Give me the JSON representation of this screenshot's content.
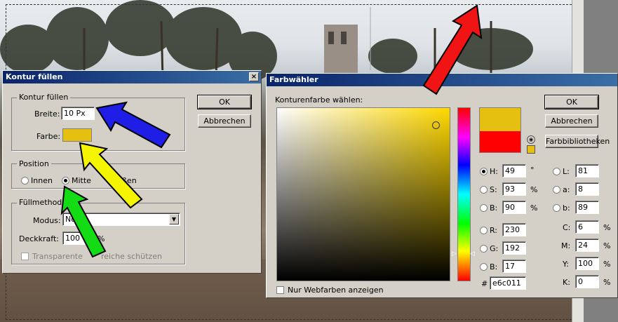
{
  "fill_dialog": {
    "title": "Kontur füllen",
    "close": "×",
    "group_stroke": "Kontur füllen",
    "width_label": "Breite:",
    "width_value": "10 Px",
    "color_label": "Farbe:",
    "color_value": "#e6c011",
    "group_position": "Position",
    "pos_inside": "Innen",
    "pos_center": "Mitte",
    "pos_outside_partial": "ßen",
    "group_blend": "Füllmethod",
    "mode_label": "Modus:",
    "mode_value": "No",
    "opacity_label": "Deckkraft:",
    "opacity_value": "100",
    "opacity_unit": "%",
    "preserve_label_a": "Transparente",
    "preserve_label_b": "reiche schützen",
    "ok": "OK",
    "cancel": "Abbrechen"
  },
  "picker": {
    "title": "Farbwähler",
    "subtitle": "Konturenfarbe wählen:",
    "ok": "OK",
    "cancel": "Abbrechen",
    "libraries": "Farbbibliotheken",
    "new_color": "#e6c011",
    "old_color": "#ff0000",
    "webonly_label": "Nur Webfarben anzeigen",
    "hex_label": "#",
    "hex_value": "e6c011",
    "hsb": [
      {
        "label": "H:",
        "value": "49",
        "unit": "°",
        "selected": true
      },
      {
        "label": "S:",
        "value": "93",
        "unit": "%"
      },
      {
        "label": "B:",
        "value": "90",
        "unit": "%"
      }
    ],
    "rgb": [
      {
        "label": "R:",
        "value": "230"
      },
      {
        "label": "G:",
        "value": "192"
      },
      {
        "label": "B:",
        "value": "17"
      }
    ],
    "lab": [
      {
        "label": "L:",
        "value": "81"
      },
      {
        "label": "a:",
        "value": "8"
      },
      {
        "label": "b:",
        "value": "89"
      }
    ],
    "cmyk": [
      {
        "label": "C:",
        "value": "6",
        "unit": "%"
      },
      {
        "label": "M:",
        "value": "24",
        "unit": "%"
      },
      {
        "label": "Y:",
        "value": "100",
        "unit": "%"
      },
      {
        "label": "K:",
        "value": "0",
        "unit": "%"
      }
    ],
    "hue_color": "#ffd800"
  },
  "arrows": {
    "blue": "#1e1ee6",
    "yellow": "#f5f500",
    "green": "#14dc14",
    "red": "#f01414"
  }
}
